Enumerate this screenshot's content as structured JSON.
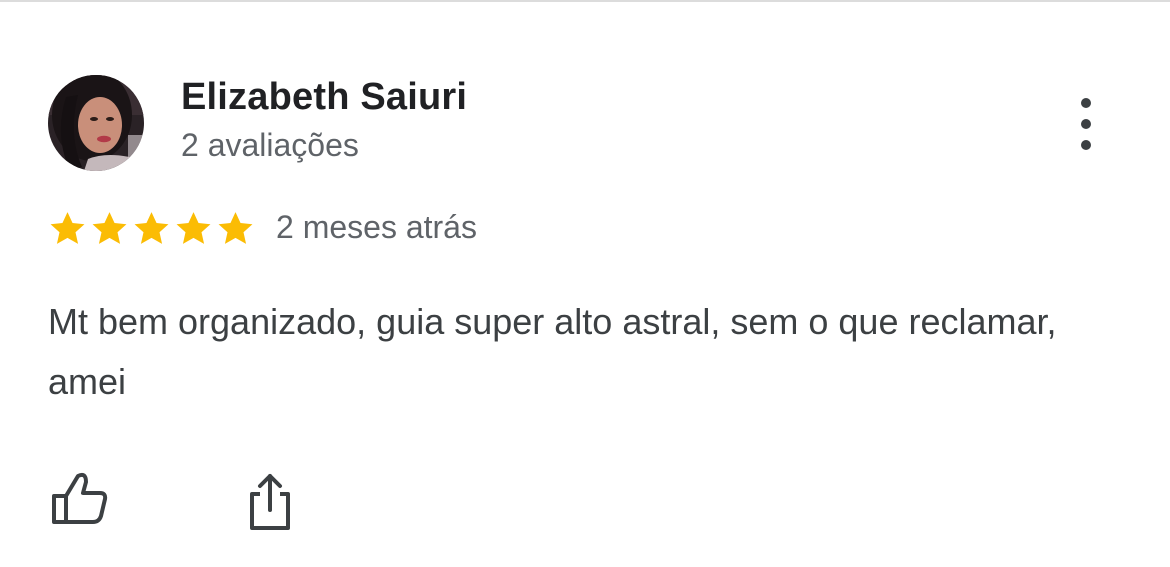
{
  "review": {
    "reviewer_name": "Elizabeth Saiuri",
    "review_count": "2 avaliações",
    "rating": 5,
    "rating_max": 5,
    "date": "2 meses atrás",
    "text": "Mt bem organizado, guia super alto astral, sem o que reclamar, amei"
  },
  "icons": {
    "more": "more-vert-icon",
    "star": "star-icon",
    "like": "thumb-up-icon",
    "share": "share-icon"
  },
  "colors": {
    "star": "#FBBC04",
    "name_text": "#202124",
    "secondary_text": "#5f6368",
    "body_text": "#3c4043",
    "icon": "#3c4043"
  }
}
